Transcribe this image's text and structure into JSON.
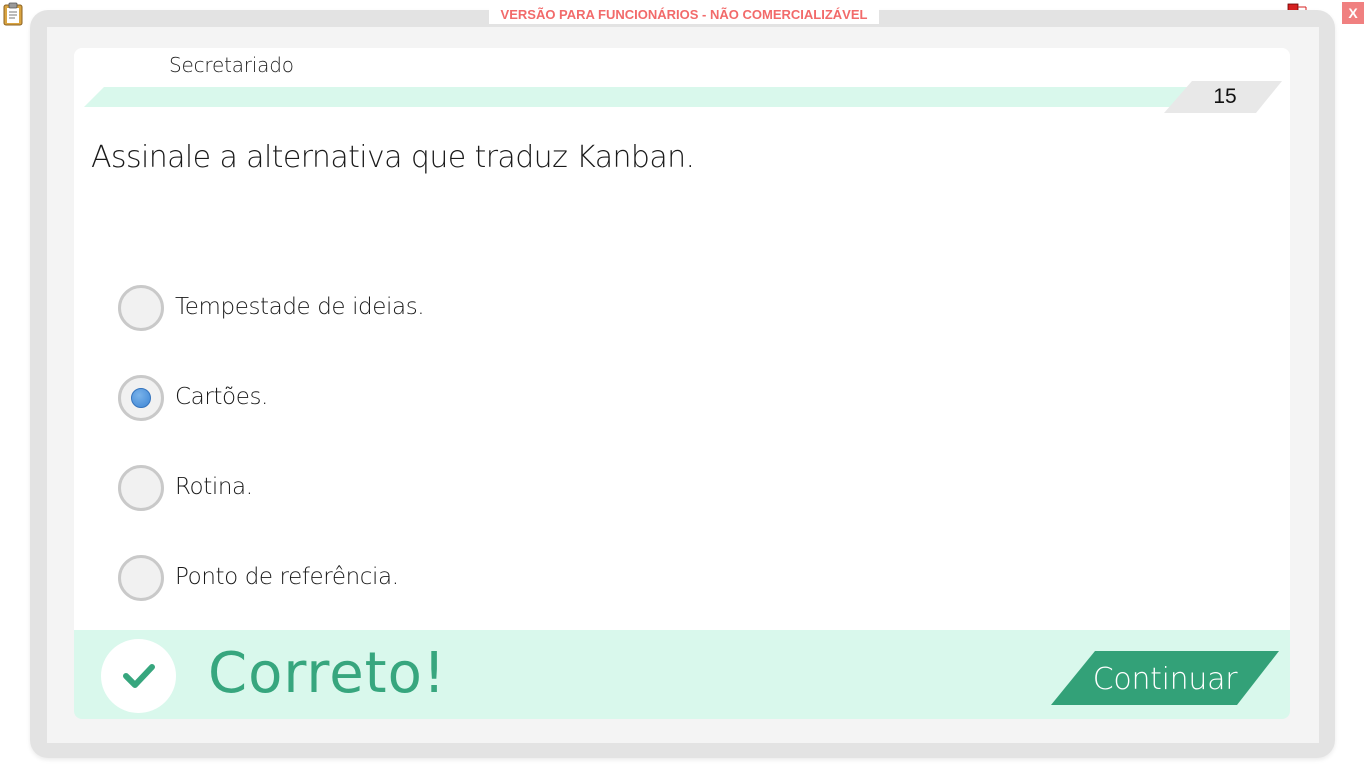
{
  "header": {
    "watermark": "VERSÃO PARA FUNCIONÁRIOS - NÃO COMERCIALIZÁVEL",
    "close_label": "X"
  },
  "icons": {
    "clipboard": "clipboard-icon",
    "network": "network-icon",
    "check": "check-icon"
  },
  "question": {
    "subject": "Secretariado",
    "number": "15",
    "text": "Assinale a alternativa que traduz Kanban.",
    "options": [
      {
        "label": "Tempestade de ideias.",
        "selected": false
      },
      {
        "label": "Cartões.",
        "selected": true
      },
      {
        "label": "Rotina.",
        "selected": false
      },
      {
        "label": "Ponto de referência.",
        "selected": false
      }
    ]
  },
  "feedback": {
    "text": "Correto!",
    "continue_label": "Continuar"
  },
  "colors": {
    "accent_green": "#37a67e",
    "button_green": "#33a178",
    "feedback_bg": "#d9f8ec",
    "subject_bar": "#d9f8ec",
    "watermark": "#f26a6a",
    "selected_dot": "#3d85d4"
  }
}
